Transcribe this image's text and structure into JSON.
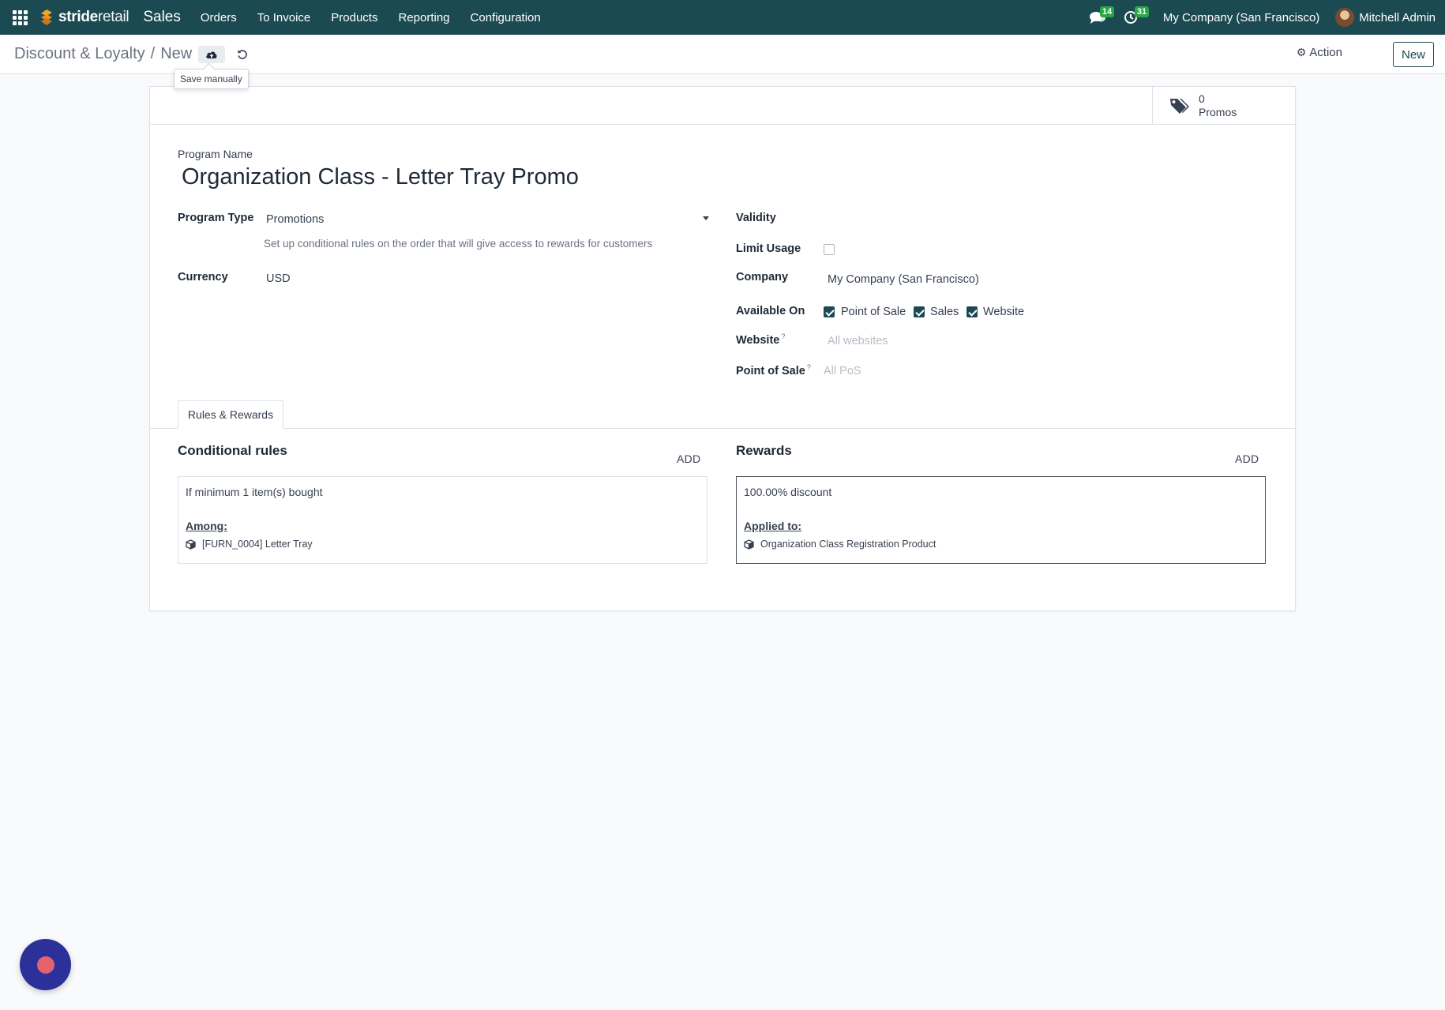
{
  "navbar": {
    "brand_bold": "stride",
    "brand_light": "retail",
    "app_name": "Sales",
    "menu": [
      "Orders",
      "To Invoice",
      "Products",
      "Reporting",
      "Configuration"
    ],
    "messages_count": "14",
    "activities_count": "31",
    "company": "My Company (San Francisco)",
    "user": "Mitchell Admin"
  },
  "control_panel": {
    "breadcrumb_parent": "Discount & Loyalty",
    "breadcrumb_separator": "/",
    "breadcrumb_current": "New",
    "save_tooltip": "Save manually",
    "action_label": "Action",
    "new_label": "New"
  },
  "stat_button": {
    "count": "0",
    "label": "Promos"
  },
  "form": {
    "program_name_label": "Program Name",
    "program_name": "Organization Class - Letter Tray Promo",
    "program_type_label": "Program Type",
    "program_type": "Promotions",
    "program_type_help": "Set up conditional rules on the order that will give access to rewards for customers",
    "currency_label": "Currency",
    "currency": "USD",
    "validity_label": "Validity",
    "limit_usage_label": "Limit Usage",
    "limit_usage": false,
    "company_label": "Company",
    "company": "My Company (San Francisco)",
    "available_on_label": "Available On",
    "available_on": [
      {
        "label": "Point of Sale",
        "checked": true
      },
      {
        "label": "Sales",
        "checked": true
      },
      {
        "label": "Website",
        "checked": true
      }
    ],
    "website_label": "Website",
    "website_help_mark": "?",
    "website_placeholder": "All websites",
    "pos_label": "Point of Sale",
    "pos_help_mark": "?",
    "pos_placeholder": "All PoS"
  },
  "tabs": [
    "Rules & Rewards"
  ],
  "rules": {
    "title": "Conditional rules",
    "add_label": "ADD",
    "card": {
      "condition": "If minimum 1 item(s) bought",
      "among_label": "Among:",
      "product": "[FURN_0004] Letter Tray"
    }
  },
  "rewards": {
    "title": "Rewards",
    "add_label": "ADD",
    "card": {
      "discount": "100.00% discount",
      "applied_label": "Applied to:",
      "product": "Organization Class Registration Product"
    }
  },
  "colors": {
    "navbar": "#1c4a52",
    "badge": "#28a745",
    "checkbox_checked": "#1c4a52",
    "chat_button": "#2b3199",
    "chat_dot": "#e4616e"
  },
  "icons": [
    "apps-grid-icon",
    "chat-icon",
    "clock-icon",
    "cloud-upload-icon",
    "undo-icon",
    "gear-icon",
    "tags-icon",
    "cube-icon"
  ]
}
